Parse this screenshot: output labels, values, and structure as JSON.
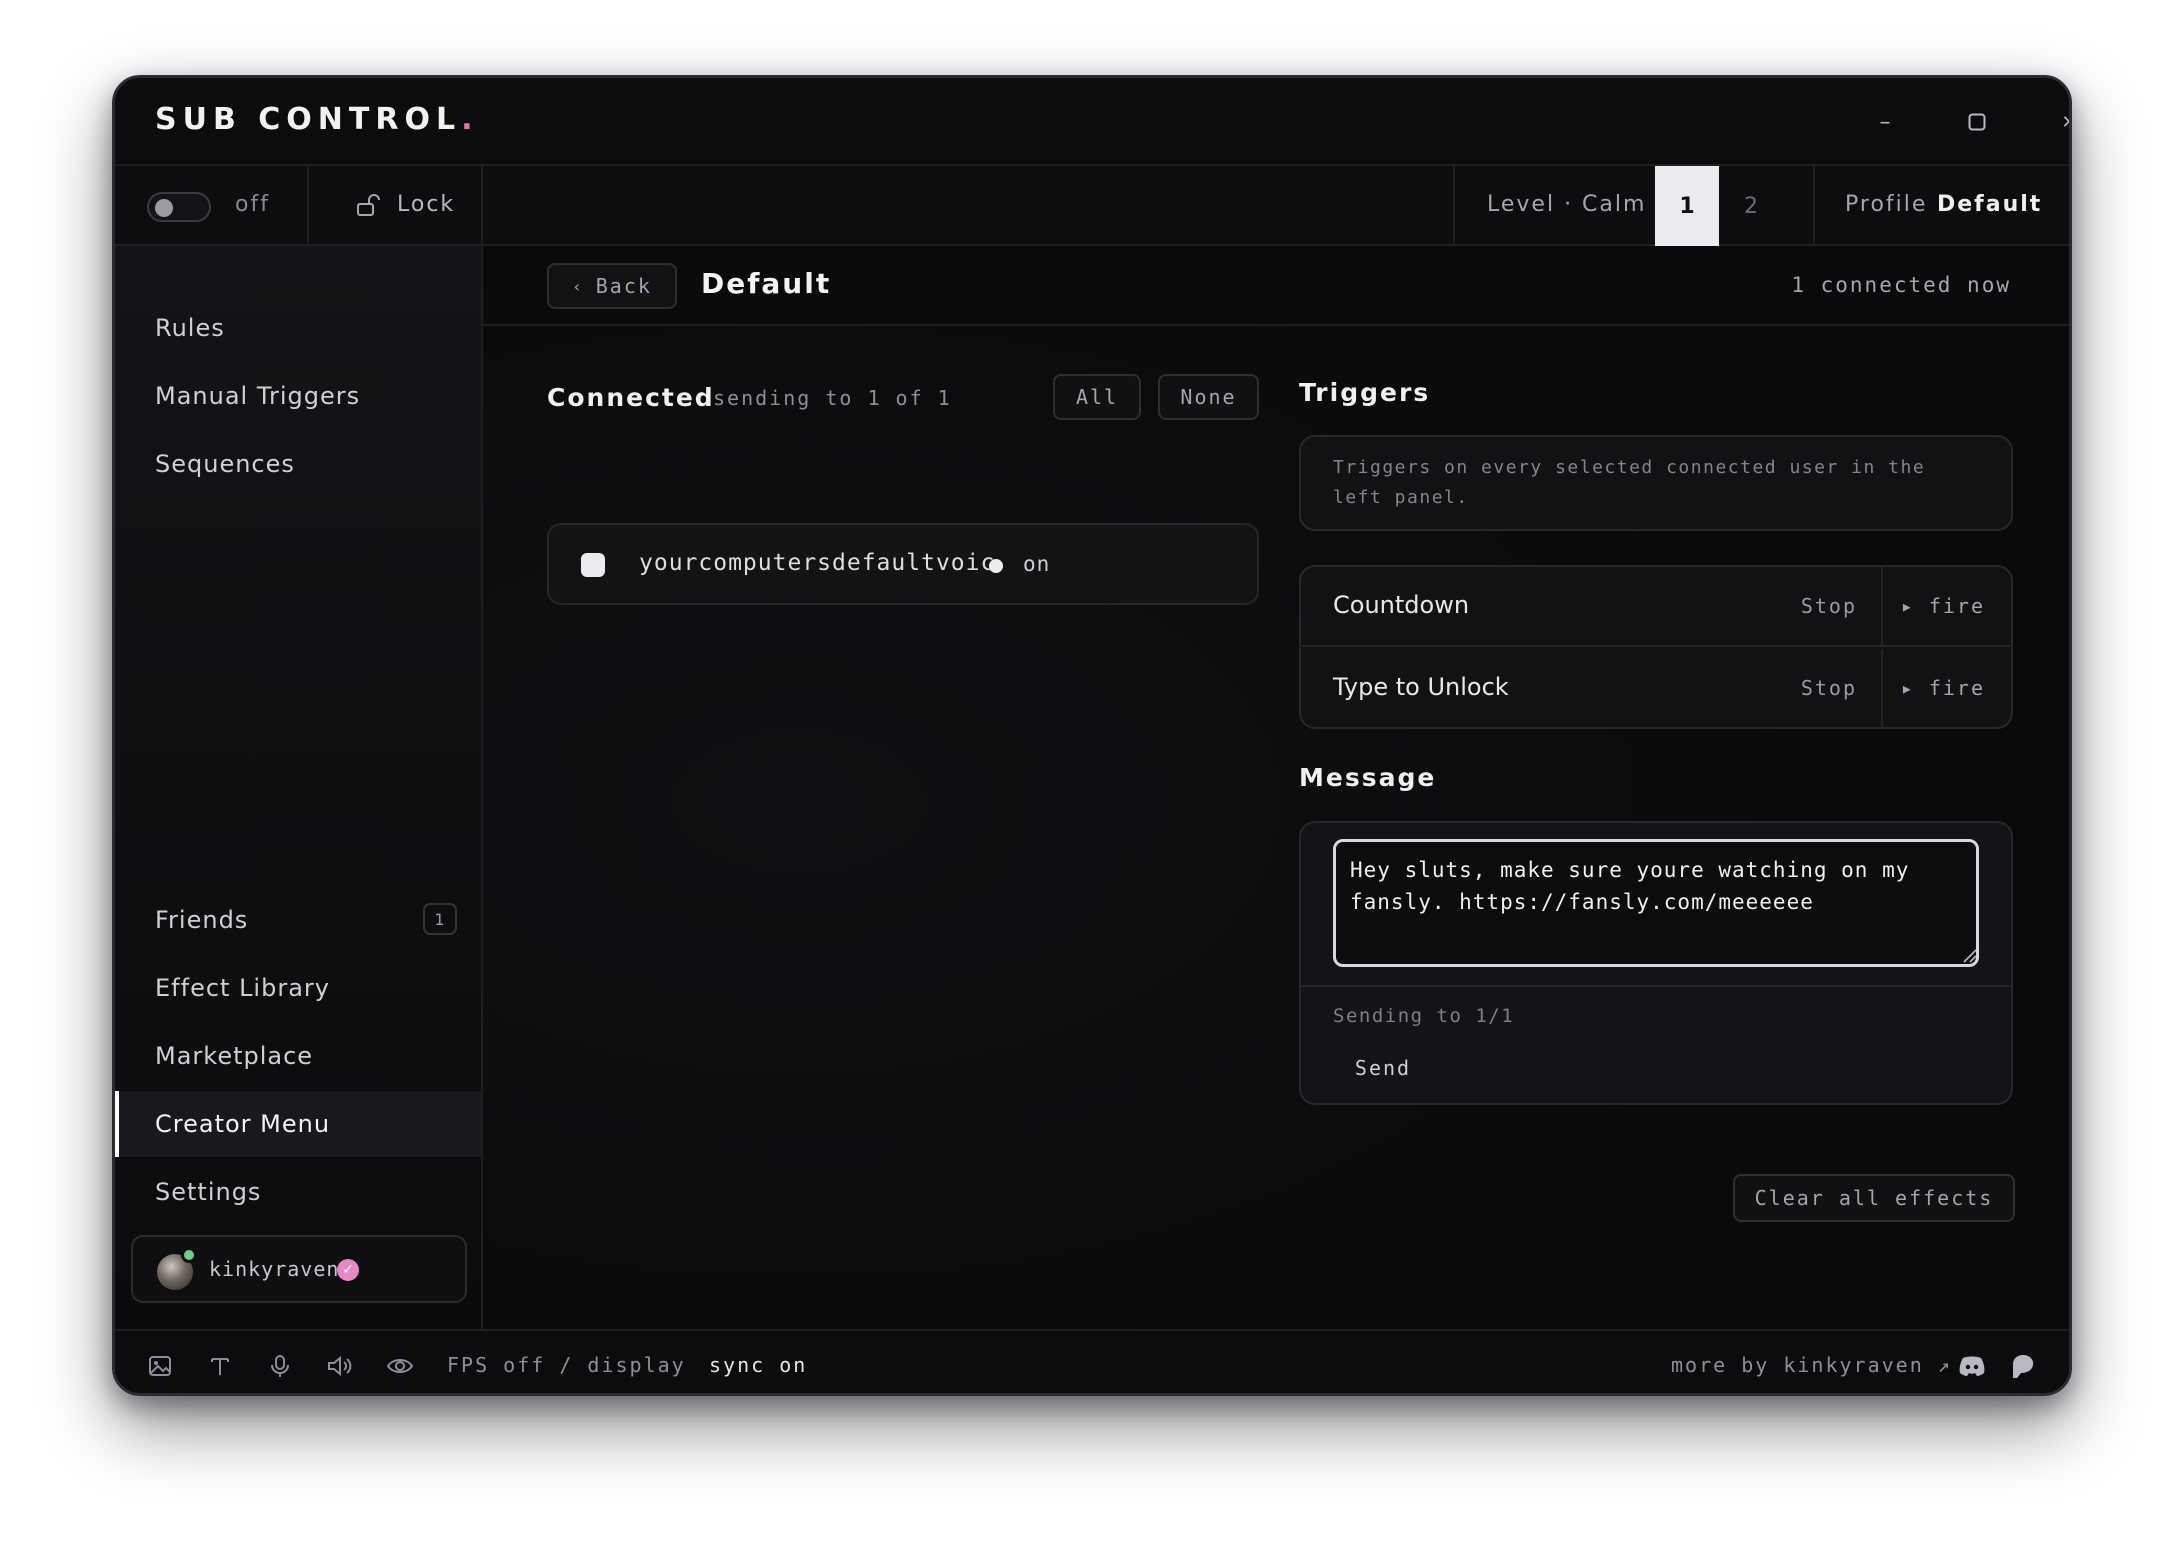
{
  "app": {
    "brand": "SUB CONTROL",
    "brand_dot": ".",
    "brand_dot_color": "#e07aa8",
    "window_controls": {
      "minimize": "–",
      "maximize": "▢",
      "close": "✕"
    }
  },
  "toolbar": {
    "toggle_state": "off",
    "lock_label": "Lock",
    "level_label": "Level · Calm",
    "levels": [
      "1",
      "2"
    ],
    "active_level": "1",
    "profile_label": "Profile",
    "profile_value": "Default"
  },
  "sidebar": {
    "top_items": [
      "Rules",
      "Manual Triggers",
      "Sequences"
    ],
    "friends": {
      "label": "Friends",
      "badge": "1"
    },
    "bottom_items": [
      "Effect Library",
      "Marketplace",
      "Creator Menu",
      "Settings"
    ],
    "active_item": "Creator Menu",
    "user": {
      "name": "kinkyraven",
      "verified_color": "#e58ac2",
      "online_color": "#6dcf8a"
    }
  },
  "header": {
    "back_label": "Back",
    "title": "Default",
    "connected_now": "1 connected now"
  },
  "connected": {
    "title": "Connected",
    "subtitle": "sending to 1 of 1",
    "all_label": "All",
    "none_label": "None",
    "users": [
      {
        "name": "yourcomputersdefaultvoic",
        "status": "on"
      }
    ]
  },
  "triggers": {
    "title": "Triggers",
    "hint": "Triggers on every selected connected user in the left panel.",
    "items": [
      {
        "name": "Countdown",
        "stop_label": "Stop",
        "fire_label": "▸ fire"
      },
      {
        "name": "Type to Unlock",
        "stop_label": "Stop",
        "fire_label": "▸ fire"
      }
    ]
  },
  "message": {
    "title": "Message",
    "value": "Hey sluts, make sure youre watching on my fansly. https://fansly.com/meeeeee",
    "sending_to": "Sending to 1/1",
    "send_label": "Send"
  },
  "actions": {
    "clear_all": "Clear all effects"
  },
  "statusbar": {
    "fps_text": "FPS off / display",
    "sync_text": "sync on",
    "more_by": "more by kinkyraven ↗"
  }
}
